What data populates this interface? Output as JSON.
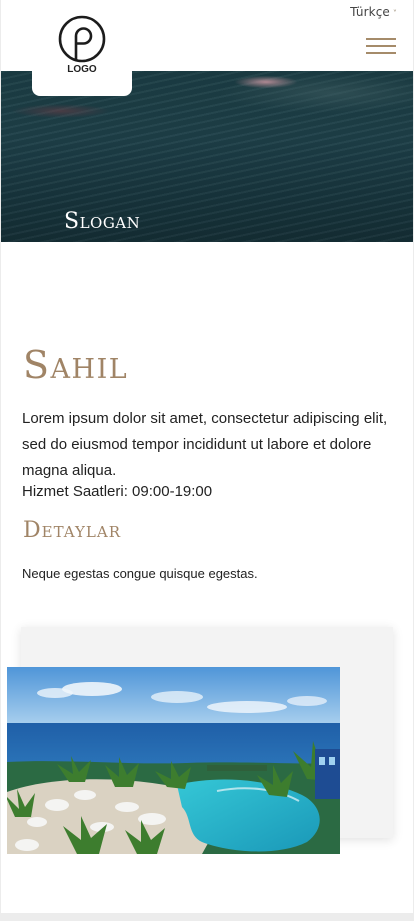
{
  "header": {
    "language_label": "Türkçe",
    "logo_text": "LOGO"
  },
  "hero": {
    "slogan": "Slogan"
  },
  "main": {
    "title": "Sahil",
    "description": "Lorem ipsum dolor sit amet, consectetur adipiscing elit, sed do eiusmod tempor incididunt ut labore et dolore magna aliqua.",
    "hours": "Hizmet Saatleri: 09:00-19:00",
    "details_title": "Detaylar",
    "details_text": "Neque egestas congue quisque egestas."
  },
  "colors": {
    "accent": "#a08466",
    "menu_lines": "#a58b6a",
    "text": "#222222",
    "panel": "#f3f3f3"
  },
  "icons": {
    "menu": "hamburger-menu-icon",
    "language_chevron": "chevron-down-icon",
    "logo": "logo-p-icon"
  }
}
